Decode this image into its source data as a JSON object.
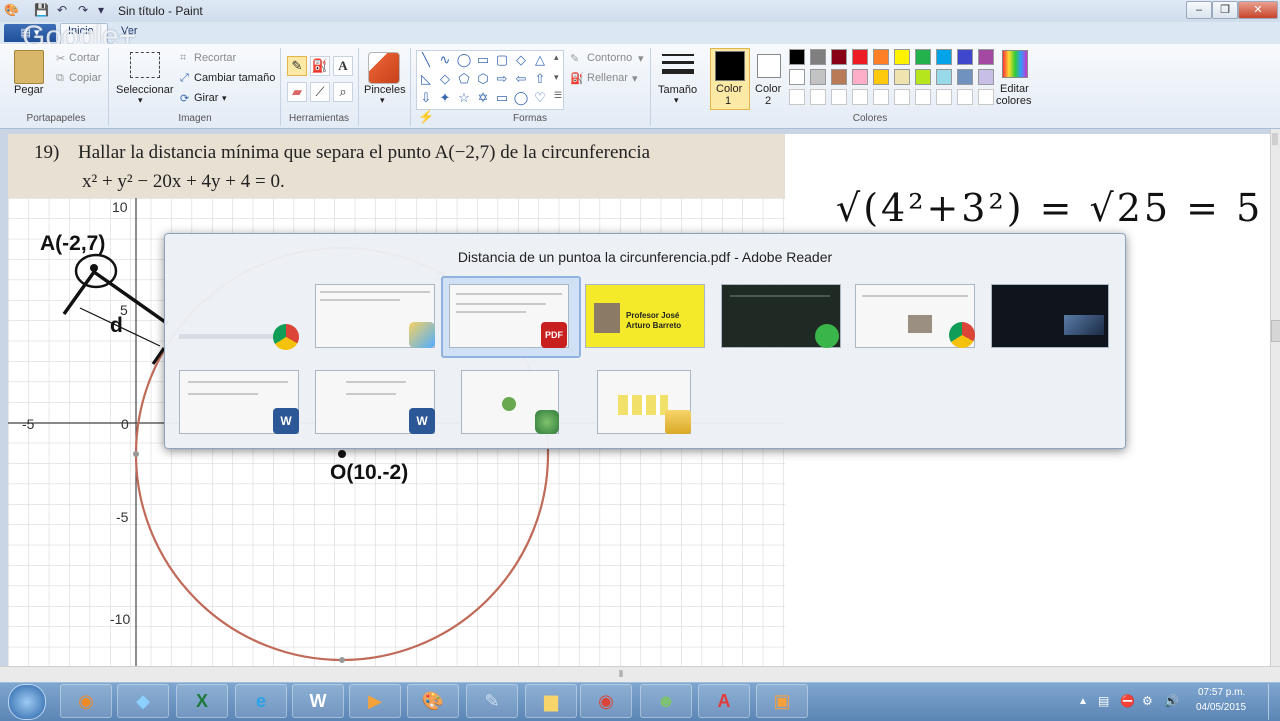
{
  "window": {
    "title": "Sin título - Paint",
    "minimize": "–",
    "restore": "❐",
    "close": "✕"
  },
  "tabs": {
    "file": "",
    "home": "Inicio",
    "view": "Ver"
  },
  "watermark": "Google+",
  "ribbon": {
    "portapapeles": {
      "label": "Portapapeles",
      "paste": "Pegar",
      "cut": "Cortar",
      "copy": "Copiar"
    },
    "imagen": {
      "label": "Imagen",
      "select": "Seleccionar",
      "crop": "Recortar",
      "resize": "Cambiar tamaño",
      "rotate": "Girar"
    },
    "herramientas": {
      "label": "Herramientas"
    },
    "pinceles": "Pinceles",
    "formas": {
      "label": "Formas",
      "outline": "Contorno",
      "fill": "Rellenar"
    },
    "tamano": "Tamaño",
    "color1": {
      "line1": "Color",
      "line2": "1"
    },
    "color2": {
      "line1": "Color",
      "line2": "2"
    },
    "colores": {
      "label": "Colores"
    },
    "edit_colors": {
      "line1": "Editar",
      "line2": "colores"
    },
    "palette_row1": [
      "#000000",
      "#7f7f7f",
      "#880015",
      "#ed1c24",
      "#ff7f27",
      "#fff200",
      "#22b14c",
      "#00a2e8",
      "#3f48cc",
      "#a349a4"
    ],
    "palette_row2": [
      "#ffffff",
      "#c3c3c3",
      "#b97a57",
      "#ffaec9",
      "#ffc90e",
      "#efe4b0",
      "#b5e61d",
      "#99d9ea",
      "#7092be",
      "#c8bfe7"
    ]
  },
  "document": {
    "problem_number": "19)",
    "problem_line1": "Hallar la distancia mínima que separa el punto A(−2,7) de la circunferencia",
    "problem_line2": "x² + y² − 20x + 4y + 4 = 0.",
    "ticks": {
      "y10": "10",
      "y5": "5",
      "y0": "0",
      "yneg5": "-5",
      "yneg10": "-10",
      "xneg5": "-5"
    },
    "point_a": "A(-2,7)",
    "label_d": "d",
    "point_o": "O(10.-2)",
    "handwriting": "√(4²+3²) = √25 = 5"
  },
  "switcher": {
    "title": "Distancia de un puntoa la circunferencia.pdf - Adobe Reader",
    "thumb_text": {
      "profesor": "Profesor José Arturo Barreto",
      "pdf": "PDF",
      "word": "W"
    }
  },
  "taskbar": {
    "time": "07:57 p.m.",
    "date": "04/05/2015"
  }
}
